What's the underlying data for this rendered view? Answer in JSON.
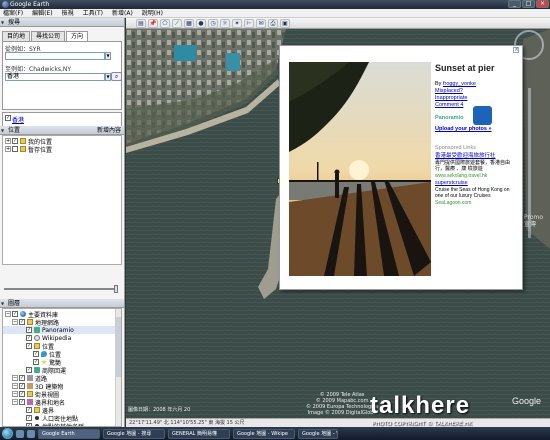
{
  "window": {
    "title": "Google Earth"
  },
  "menu": [
    "檔案(F)",
    "編輯(E)",
    "檢視",
    "工具(T)",
    "新增(A)",
    "說明(H)"
  ],
  "search": {
    "header": "搜尋",
    "tabs": [
      "目的地",
      "尋找公司",
      "方向"
    ],
    "from_label": "從例如：SYR",
    "to_label": "至例如：Chadwicks,NY",
    "to_value": "香港",
    "result": "香港"
  },
  "places": {
    "header": "位置",
    "add_content": "新增內容",
    "items": [
      "我的位置",
      "暫存位置"
    ]
  },
  "layers": {
    "header": "圖層",
    "items": [
      {
        "label": "主要資料庫",
        "level": 0,
        "icon": "globe-icon"
      },
      {
        "label": "地理網路",
        "level": 1,
        "icon": "folder-icon"
      },
      {
        "label": "Panoramio",
        "level": 2,
        "icon": "panoramio-icon"
      },
      {
        "label": "Wikipedia",
        "level": 2,
        "icon": "wikipedia-icon"
      },
      {
        "label": "位置",
        "level": 2,
        "icon": "folder-icon"
      },
      {
        "label": "位置",
        "level": 3,
        "icon": "pin-icon"
      },
      {
        "label": "驚艷",
        "level": 3,
        "icon": "star-icon"
      },
      {
        "label": "商際回運",
        "level": 2,
        "icon": "pano-icon"
      },
      {
        "label": "道路",
        "level": 1,
        "icon": "road-icon"
      },
      {
        "label": "3D 建築物",
        "level": 1,
        "icon": "building-icon"
      },
      {
        "label": "街景視圖",
        "level": 1,
        "icon": "street-icon"
      },
      {
        "label": "邊界和地名",
        "level": 1,
        "icon": "border-icon"
      },
      {
        "label": "邊界",
        "level": 2,
        "icon": "folder-icon"
      },
      {
        "label": "人口密住地點",
        "level": 2,
        "icon": "dot-icon"
      },
      {
        "label": "地點的其他名稱",
        "level": 2,
        "icon": "dot-icon"
      }
    ]
  },
  "balloon": {
    "title": "Sunset at pier",
    "by_label": "By",
    "author": "froggy_vonke",
    "links": [
      "Misplaced?",
      "Inappropriate",
      "Comment 4"
    ],
    "brand": "Panoramio",
    "upload": "Upload your photos »",
    "sponsored": "Sponsored Links",
    "ad_title": "香港最受歡迎海旅旅行社",
    "ad_desc": "專門提供國際旅遊套餐，香港自由行，醫療 、康 檢旅遊",
    "ad_url": "www.sekolang.travel.hk",
    "ad2_title": "superstcruise",
    "ad2_desc": "Cruise the Seas of Hong Kong on one of our luxury Cruises",
    "ad2_url": "SeaLagoon.com"
  },
  "map_labels": {
    "attribution": "© 2009 Tele Atlas\n© 2009 Mapabc.com\n© 2009 Europa Technologies\nImage © 2009 DigitalGlobe",
    "date": "圖像日期：2008 年六月 20",
    "status": "22°17'11.49\" 北  114°10'55.25\" 東  海拔 15 公尺",
    "google": "Google",
    "promo": "Promo\n宣傳"
  },
  "watermark": {
    "text": "talkhere",
    "copyright": "PHOTO COPYRIGHT © TALKHERE.HK"
  },
  "taskbar": [
    "Google Earth",
    "Google 地圖 - 搜尋",
    "GENERAL 簡明易懂",
    "Google 地圖 - Wikipe",
    "Google 地圖 - Win"
  ]
}
